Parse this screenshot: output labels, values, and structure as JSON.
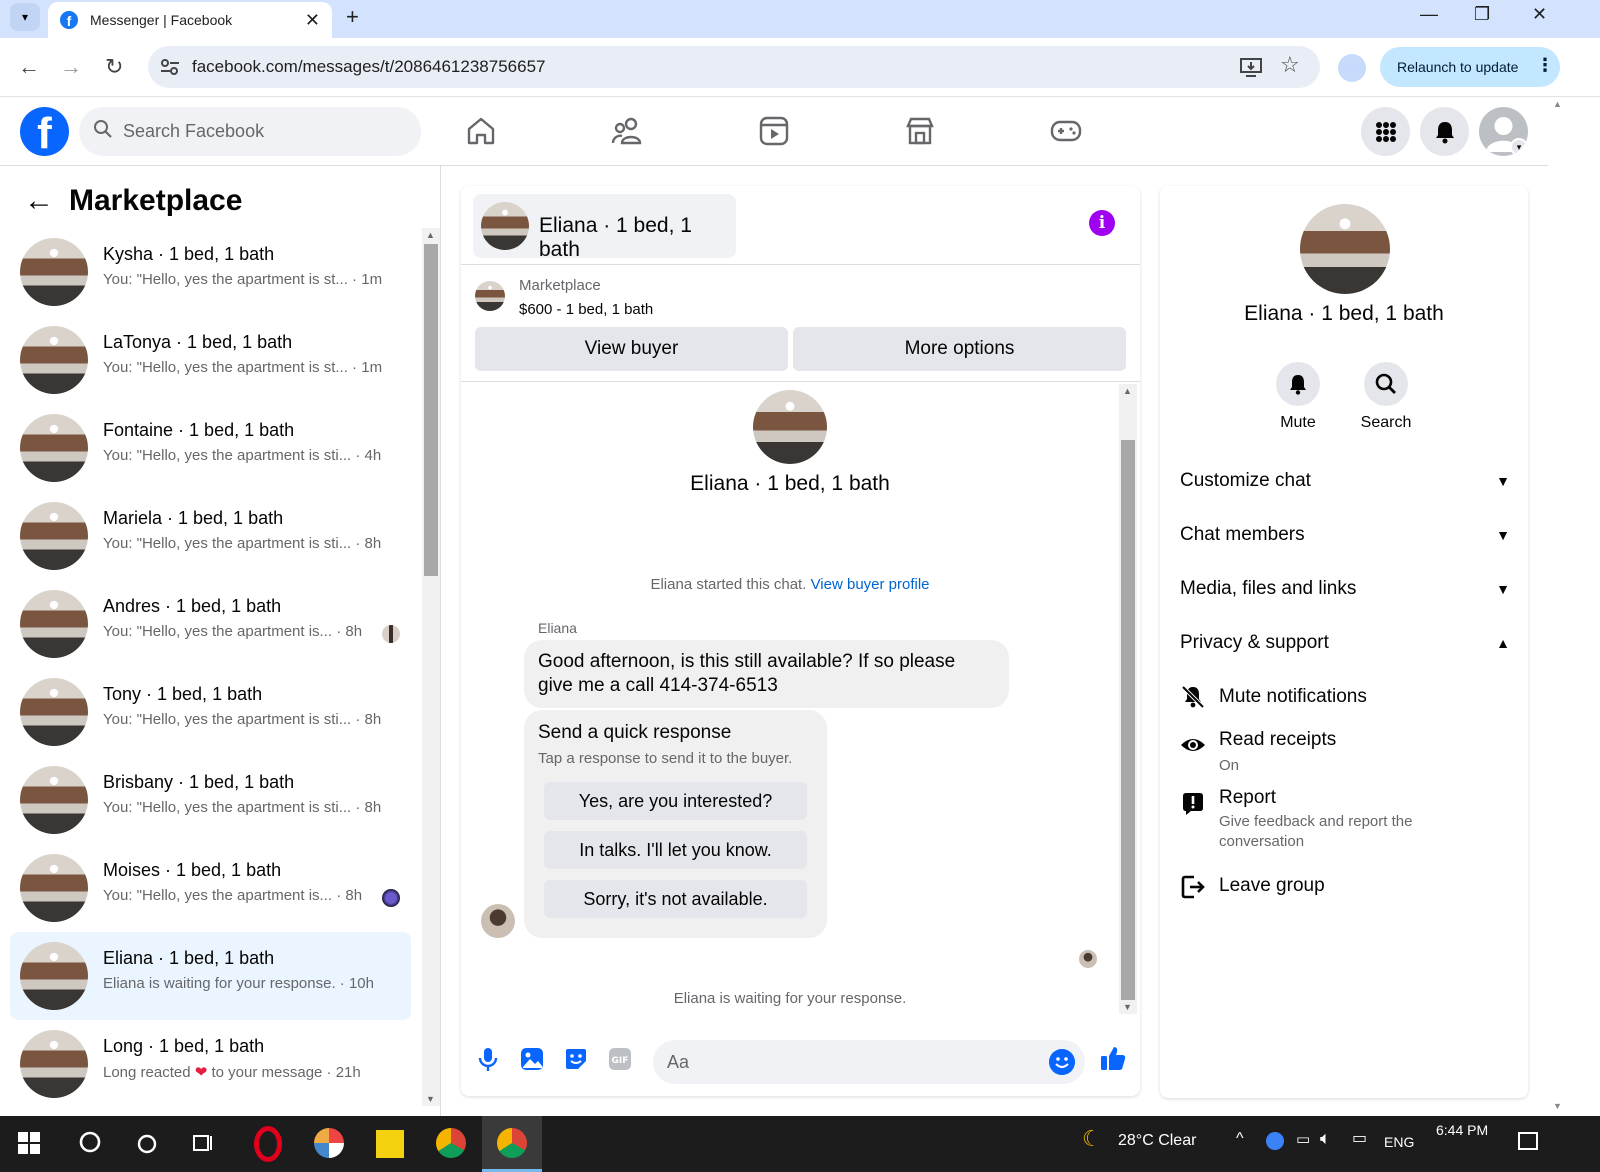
{
  "browser": {
    "tab_title": "Messenger | Facebook",
    "url": "facebook.com/messages/t/2086461238756657",
    "relaunch_label": "Relaunch to update"
  },
  "fb": {
    "logo": "f",
    "search_placeholder": "Search Facebook"
  },
  "left": {
    "title": "Marketplace",
    "chats": [
      {
        "name": "Kysha · 1 bed, 1 bath",
        "preview": "You: \"Hello, yes the apartment is st... · 1m"
      },
      {
        "name": "LaTonya · 1 bed, 1 bath",
        "preview": "You: \"Hello, yes the apartment is st... · 1m"
      },
      {
        "name": "Fontaine · 1 bed, 1 bath",
        "preview": "You: \"Hello, yes the apartment is sti... · 4h"
      },
      {
        "name": "Mariela · 1 bed, 1 bath",
        "preview": "You: \"Hello, yes the apartment is sti... · 8h"
      },
      {
        "name": "Andres · 1 bed, 1 bath",
        "preview": "You: \"Hello, yes the apartment is... · 8h"
      },
      {
        "name": "Tony · 1 bed, 1 bath",
        "preview": "You: \"Hello, yes the apartment is sti... · 8h"
      },
      {
        "name": "Brisbany · 1 bed, 1 bath",
        "preview": "You: \"Hello, yes the apartment is sti... · 8h"
      },
      {
        "name": "Moises · 1 bed, 1 bath",
        "preview": "You: \"Hello, yes the apartment is... · 8h"
      },
      {
        "name": "Eliana · 1 bed, 1 bath",
        "preview": "Eliana is waiting for your response. · 10h"
      },
      {
        "name": "Long · 1 bed, 1 bath",
        "preview_a": "Long reacted",
        "preview_b": "to your message · 21h"
      }
    ]
  },
  "conversation": {
    "title": "Eliana · 1 bed, 1 bath",
    "listing_label": "Marketplace",
    "listing_price": "$600 - 1 bed, 1 bath",
    "view_buyer": "View buyer",
    "more_options": "More options",
    "started_text": "Eliana started this chat.",
    "view_profile_link": "View buyer profile",
    "sender": "Eliana",
    "message": "Good afternoon, is this still available? If so please give me a call 414-374-6513",
    "quick_title": "Send a quick response",
    "quick_sub": "Tap a response to send it to the buyer.",
    "quick_options": [
      "Yes, are you interested?",
      "In talks. I'll let you know.",
      "Sorry, it's not available."
    ],
    "waiting": "Eliana is waiting for your response.",
    "input_placeholder": "Aa"
  },
  "info": {
    "name": "Eliana · 1 bed, 1 bath",
    "mute": "Mute",
    "search": "Search",
    "sections": [
      "Customize chat",
      "Chat members",
      "Media, files and links",
      "Privacy & support"
    ],
    "mute_notifications": "Mute notifications",
    "read_receipts": "Read receipts",
    "read_receipts_state": "On",
    "report": "Report",
    "report_sub": "Give feedback and report the conversation",
    "leave_group": "Leave group"
  },
  "taskbar": {
    "weather": "28°C  Clear",
    "lang": "ENG",
    "time": "6:44 PM"
  },
  "colors": {
    "fb_blue": "#0866ff",
    "messenger_purple": "#a000f0",
    "active_chat_bg": "#ebf5ff"
  }
}
